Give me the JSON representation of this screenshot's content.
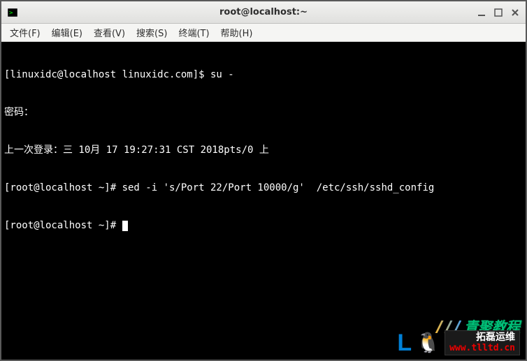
{
  "window": {
    "title": "root@localhost:~"
  },
  "menu": {
    "file": "文件(F)",
    "edit": "编辑(E)",
    "view": "查看(V)",
    "search": "搜索(S)",
    "terminal": "终端(T)",
    "help": "帮助(H)"
  },
  "terminal": {
    "lines": [
      "[linuxidc@localhost linuxidc.com]$ su -",
      "密码：",
      "上一次登录：三 10月 17 19:27:31 CST 2018pts/0 上",
      "[root@localhost ~]# sed -i 's/Port 22/Port 10000/g'  /etc/ssh/sshd_config",
      "[root@localhost ~]# "
    ]
  },
  "watermark": {
    "qj_text": "青聚教程",
    "name": "拓磊运维",
    "url": "www.tlltd.cn"
  }
}
